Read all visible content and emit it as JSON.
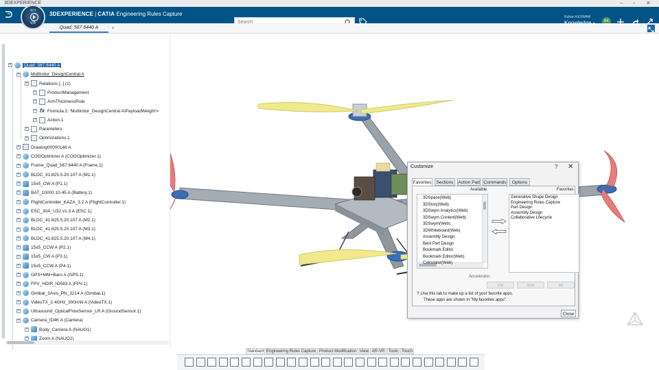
{
  "window": {
    "title": "3DEXPERIENCE",
    "controls": [
      "–",
      "▫",
      "✕"
    ]
  },
  "topbar": {
    "brand_3d": "3DEXPERIENCE",
    "brand_catia": "CATIA",
    "brand_app": "Engineering Rules Capture",
    "search_placeholder": "Search",
    "user_name": "Ruhan KESWAM",
    "app_name": "Knowledge",
    "avatar_initials": "RK",
    "compass_label": "V,R",
    "compass_nums": "3D  ⌖"
  },
  "tabs": {
    "doc_tab": "Quad_567.6440 A",
    "add": "+"
  },
  "tree": {
    "rows": [
      {
        "label": "Quad_567.6440 A",
        "indent": 0,
        "icon": "prod",
        "selected": true
      },
      {
        "label": "Multirotor_DesignCentral A",
        "indent": 1,
        "icon": "prod",
        "underline": true
      },
      {
        "label": "Relations [..] (1)",
        "indent": 2,
        "icon": "rel"
      },
      {
        "label": "ProductManagement",
        "indent": 3,
        "icon": "param"
      },
      {
        "label": "ArmThicknessRule",
        "indent": 3,
        "icon": "param"
      },
      {
        "label": "Formula.2: 'Multirotor_DesignCentral A\\PayloadWeight'=",
        "indent": 3,
        "icon": "fx"
      },
      {
        "label": "Action.1",
        "indent": 3,
        "icon": "param"
      },
      {
        "label": "Parameters",
        "indent": 2,
        "icon": "param"
      },
      {
        "label": "Optimizations.1",
        "indent": 2,
        "icon": "rel"
      },
      {
        "label": "Drawing00000148 A",
        "indent": 1,
        "icon": "draw"
      },
      {
        "label": "COGOptimizer A (COGOptimizer.1)",
        "indent": 1,
        "icon": "prod"
      },
      {
        "label": "Frame_Quad_567.6440 A (Frame.1)",
        "indent": 1,
        "icon": "prod"
      },
      {
        "label": "BLDC_41.825.5.20.107 A (M1.1)",
        "indent": 1,
        "icon": "prod"
      },
      {
        "label": "15x5_CW A (P1.1)",
        "indent": 1,
        "icon": "part"
      },
      {
        "label": "BAT_10000.10.45 A (Battery.1)",
        "indent": 1,
        "icon": "part"
      },
      {
        "label": "FlightController_KAZA_3.2 A (FlightController.1)",
        "indent": 1,
        "icon": "prod"
      },
      {
        "label": "ESC_30A_U32.v1.3 A (ESC.1)",
        "indent": 1,
        "icon": "prod"
      },
      {
        "label": "BLDC_41.825.5.20.107 A (M2.1)",
        "indent": 1,
        "icon": "prod"
      },
      {
        "label": "BLDC_41.825.5.20.107 A (M3.1)",
        "indent": 1,
        "icon": "prod"
      },
      {
        "label": "BLDC_41.825.5.20.107 A (M4.1)",
        "indent": 1,
        "icon": "prod"
      },
      {
        "label": "15x5_CCW A (P2.1)",
        "indent": 1,
        "icon": "part"
      },
      {
        "label": "15x5_CW A (P3.1)",
        "indent": 1,
        "icon": "part"
      },
      {
        "label": "15x5_CCW A (P4.1)",
        "indent": 1,
        "icon": "part"
      },
      {
        "label": "GPS+MM+Baro A (GPS.1)",
        "indent": 1,
        "icon": "prod"
      },
      {
        "label": "FPV_HDIR_IO583 A (FPV.1)",
        "indent": 1,
        "icon": "prod"
      },
      {
        "label": "Gimbal_3Axis_PN_3214 A (Gimbal.1)",
        "indent": 1,
        "icon": "prod"
      },
      {
        "label": "VideoTX_2.4GHz_300mW A (VideoTX.1)",
        "indent": 1,
        "icon": "prod"
      },
      {
        "label": "Ultrasound_OpticalFlowSensor_LR A (GroundSensor.1)",
        "indent": 1,
        "icon": "prod"
      },
      {
        "label": "Camera_ID4K A (Camera)",
        "indent": 1,
        "icon": "prod"
      },
      {
        "label": "Body_Camera A (NAUO1)",
        "indent": 2,
        "icon": "part"
      },
      {
        "label": "Zoom A (NAUO2)",
        "indent": 2,
        "icon": "part"
      }
    ]
  },
  "dialog": {
    "title": "Customize",
    "help": "?",
    "close": "✕",
    "tabs": [
      "Favorites",
      "Sections",
      "Action Pad",
      "Commands",
      "Options"
    ],
    "active_tab": "Favorites",
    "available_label": "Available",
    "favorites_label": "Favorites",
    "available": [
      "3DSpace(Web)",
      "3DStory(Web)",
      "3DSwym Analytics(Web)",
      "3DSwym Content(Web)",
      "3DSwym(Web)",
      "3DWhiteboard(Web)",
      "Assembly Design",
      "Bent Part Design",
      "Bookmark Editor",
      "Bookmark Editor(Web)",
      "Calculator(Web)"
    ],
    "favorites": [
      "Generative Shape Design",
      "Engineering Rules Capture",
      "Part Design",
      "Assembly Design",
      "Collaborative Lifecycle"
    ],
    "accelerator_label": "Accelerator:",
    "accel_buttons": [
      "Ctrl",
      "Shift",
      "Alt"
    ],
    "info_line1": "Use this tab to make up a list of your favorite apps.",
    "info_line2": "These apps are shown in \"My favorites apps\".",
    "close_button": "Close"
  },
  "actionbar": {
    "tabs": [
      "Standard",
      "Engineering Rules Capture",
      "Product Modification",
      "View",
      "AR-VR",
      "Tools",
      "Touch"
    ],
    "active_tab": "Standard"
  },
  "colors": {
    "topbar": "#005386",
    "selection": "#1f5fa8",
    "frame": "#8c959e",
    "propeller": "#f0ea8a",
    "propeller_red": "#e87c7c",
    "motor": "#3a6fb8"
  }
}
